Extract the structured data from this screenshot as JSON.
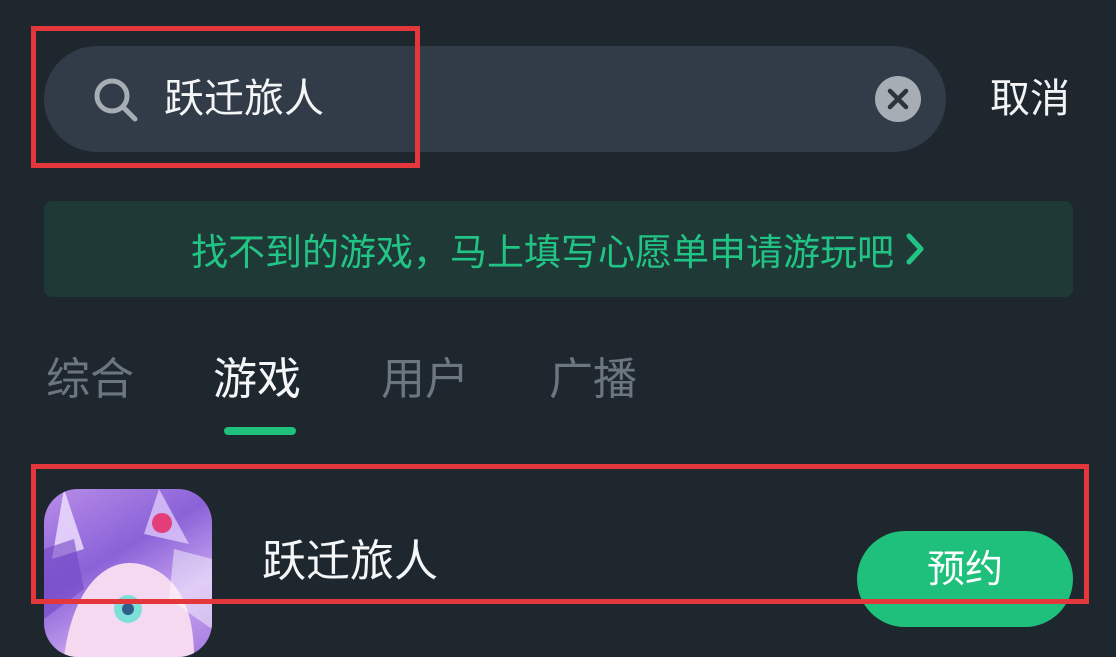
{
  "search": {
    "query": "跃迁旅人",
    "icon": "search-icon",
    "clear_icon": "close-icon"
  },
  "cancel_label": "取消",
  "banner": {
    "text": "找不到的游戏，马上填写心愿单申请游玩吧",
    "icon": "chevron-right-icon"
  },
  "tabs": [
    {
      "label": "综合",
      "active": false
    },
    {
      "label": "游戏",
      "active": true
    },
    {
      "label": "用户",
      "active": false
    },
    {
      "label": "广播",
      "active": false
    }
  ],
  "results": [
    {
      "name": "跃迁旅人",
      "action_label": "预约"
    }
  ],
  "colors": {
    "background": "#1f272e",
    "search_field": "#313c48",
    "accent": "#1fc07c",
    "banner_text": "#22c486",
    "banner_bg": "#1f3a36",
    "highlight": "#e4373b"
  }
}
